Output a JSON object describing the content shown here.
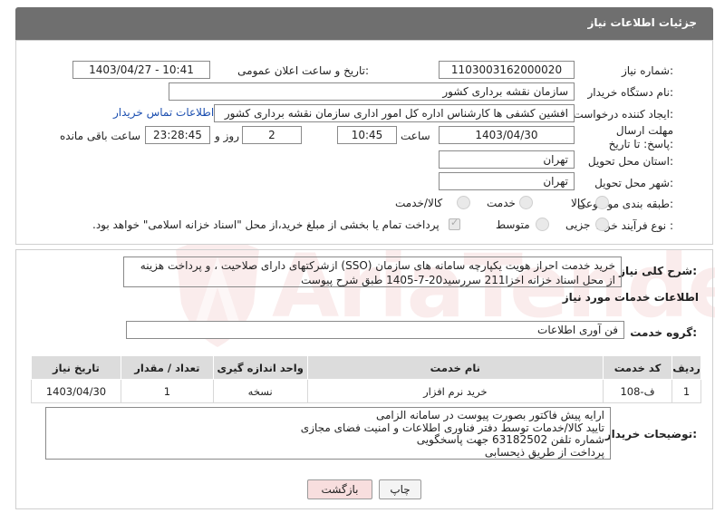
{
  "header": {
    "title": "جزئیات اطلاعات نیاز"
  },
  "form": {
    "need_number": {
      "label": "شماره نیاز:",
      "value": "1103003162000020"
    },
    "announce_datetime": {
      "label": "تاریخ و ساعت اعلان عمومی:",
      "value": "1403/04/27 - 10:41"
    },
    "buyer_org": {
      "label": "نام دستگاه خریدار:",
      "value": "سازمان نقشه برداری کشور"
    },
    "requester": {
      "label": "ایجاد کننده درخواست:",
      "value": "افشین کشفی ها کارشناس اداره کل امور اداری سازمان نقشه برداری کشور",
      "contact_link": "اطلاعات تماس خریدار"
    },
    "deadline": {
      "label": "مهلت ارسال پاسخ: تا تاریخ:",
      "date": "1403/04/30",
      "time_label": "ساعت",
      "time": "10:45",
      "days": "2",
      "days_label": "روز و",
      "remaining": "23:28:45",
      "remaining_label": "ساعت باقی مانده"
    },
    "delivery_province": {
      "label": "استان محل تحویل:",
      "value": "تهران"
    },
    "delivery_city": {
      "label": "شهر محل تحویل:",
      "value": "تهران"
    },
    "category": {
      "label": "طبقه بندی موضوعی:",
      "options": [
        "کالا",
        "خدمت",
        "کالا/خدمت"
      ]
    },
    "purchase_type": {
      "label": "نوع فرآیند خرید :",
      "options": [
        "جزیی",
        "متوسط"
      ],
      "note": "پرداخت تمام یا بخشی از مبلغ خرید،از محل \"اسناد خزانه اسلامی\" خواهد بود."
    }
  },
  "summary": {
    "label": "شرح کلی نیاز:",
    "value": "خرید خدمت احراز هویت یکپارچه سامانه های سازمان (SSO) ازشرکتهای دارای صلاحیت ، و پرداخت هزینه از محل اسناد خزانه اخزا211 سررسید20-7-1405 طبق شرح پیوست"
  },
  "services": {
    "title": "اطلاعات خدمات مورد نیاز",
    "group_label": "گروه خدمت:",
    "group_value": "فن آوری اطلاعات",
    "columns": [
      "ردیف",
      "کد خدمت",
      "نام خدمت",
      "واحد اندازه گیری",
      "تعداد / مقدار",
      "تاریخ نیاز"
    ],
    "rows": [
      {
        "row": "1",
        "code": "ف-108",
        "name": "خرید نرم افزار",
        "unit": "نسخه",
        "qty": "1",
        "date": "1403/04/30"
      }
    ]
  },
  "buyer_notes": {
    "label": "توضیحات خریدار:",
    "lines": [
      "ارایه پیش فاکتور بصورت پیوست در سامانه الزامی",
      "تایید کالا/خدمات توسط دفتر فناوری اطلاعات و امنیت فضای مجازی",
      "شماره تلفن 63182502 جهت پاسخگویی",
      "پرداخت از طریق ذیحسابی"
    ]
  },
  "buttons": {
    "print": "چاپ",
    "back": "بازگشت"
  },
  "watermark": {
    "text": "AriaTender.neT"
  },
  "colors": {
    "header_bg": "#6f6f6f",
    "link": "#1c4fb0",
    "back_button_bg": "#f8dede",
    "table_header_bg": "#dcdcdc"
  }
}
